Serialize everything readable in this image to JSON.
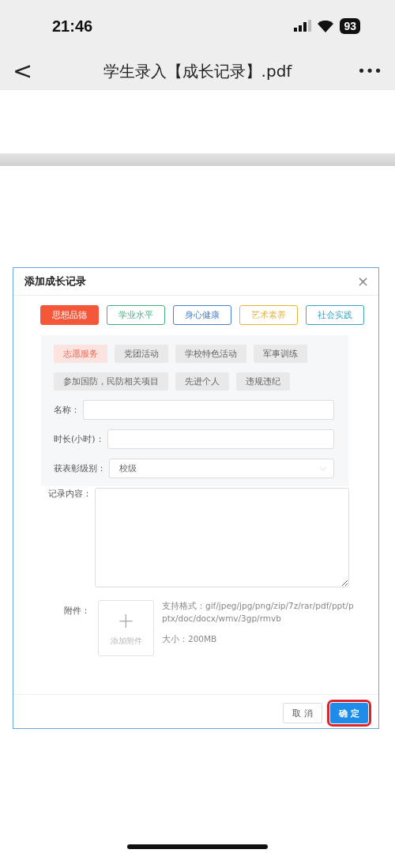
{
  "status_bar": {
    "time": "21:46",
    "battery": "93"
  },
  "nav_bar": {
    "back": "<",
    "title": "学生录入【成长记录】.pdf",
    "more": "•••"
  },
  "dialog": {
    "title": "添加成长记录",
    "close": "×",
    "categories": [
      {
        "label": "思想品德",
        "selected": true,
        "color": "#f4573a"
      },
      {
        "label": "学业水平",
        "selected": false,
        "color": "#3fb27f"
      },
      {
        "label": "身心健康",
        "selected": false,
        "color": "#4a7fc9"
      },
      {
        "label": "艺术素养",
        "selected": false,
        "color": "#e8b53a"
      },
      {
        "label": "社会实践",
        "selected": false,
        "color": "#3aa7c9"
      }
    ],
    "subtags": [
      {
        "label": "志愿服务",
        "selected": true
      },
      {
        "label": "党团活动",
        "selected": false
      },
      {
        "label": "学校特色活动",
        "selected": false
      },
      {
        "label": "军事训练",
        "selected": false
      },
      {
        "label": "参加国防，民防相关项目",
        "selected": false
      },
      {
        "label": "先进个人",
        "selected": false
      },
      {
        "label": "违规违纪",
        "selected": false
      }
    ],
    "fields": [
      {
        "kind": "input",
        "label": "名称："
      },
      {
        "kind": "input",
        "label": "时长(小时)："
      },
      {
        "kind": "select",
        "label": "获表彰级别：",
        "value": "校级"
      }
    ],
    "content": {
      "label": "记录内容："
    },
    "attachment": {
      "label": "附件：",
      "plus": "+",
      "button": "添加附件",
      "formats": "支持格式：gif/jpeg/jpg/png/zip/7z/rar/pdf/ppt/pptx/doc/docx/wmv/3gp/rmvb",
      "size": "大小：200MB"
    },
    "buttons": [
      {
        "label": "取 消",
        "kind": "default",
        "highlighted": false
      },
      {
        "label": "确 定",
        "kind": "primary",
        "highlighted": true
      }
    ]
  }
}
